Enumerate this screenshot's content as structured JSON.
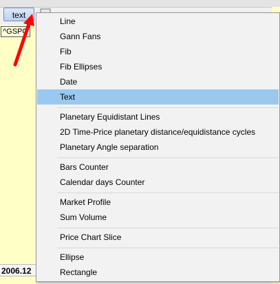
{
  "toolbar": {
    "text_button_label": "text"
  },
  "chart": {
    "symbol_label": "^GSPC",
    "bottom_label": "2006.12"
  },
  "menu": {
    "items": [
      {
        "label": "Line"
      },
      {
        "label": "Gann Fans"
      },
      {
        "label": "Fib"
      },
      {
        "label": "Fib Ellipses"
      },
      {
        "label": "Date"
      },
      {
        "label": "Text",
        "highlighted": true
      },
      {
        "label": "Planetary Equidistant Lines"
      },
      {
        "label": "2D Time-Price planetary distance/equidistance cycles"
      },
      {
        "label": "Planetary Angle separation"
      },
      {
        "label": "Bars Counter"
      },
      {
        "label": "Calendar days Counter"
      },
      {
        "label": "Market Profile"
      },
      {
        "label": "Sum Volume"
      },
      {
        "label": "Price Chart Slice"
      },
      {
        "label": "Ellipse"
      },
      {
        "label": "Rectangle"
      }
    ]
  },
  "colors": {
    "menu_highlight": "#99c9ef",
    "chart_background": "#ffffc6",
    "annotation_arrow": "#ff0000"
  }
}
